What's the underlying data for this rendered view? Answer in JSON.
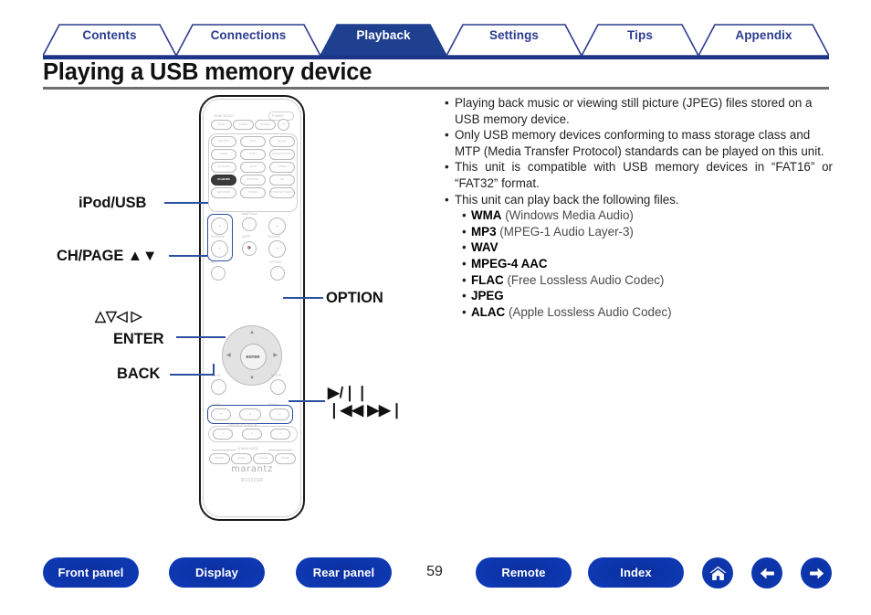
{
  "tabs": [
    {
      "label": "Contents",
      "active": false
    },
    {
      "label": "Connections",
      "active": false
    },
    {
      "label": "Playback",
      "active": true
    },
    {
      "label": "Settings",
      "active": false
    },
    {
      "label": "Tips",
      "active": false
    },
    {
      "label": "Appendix",
      "active": false
    }
  ],
  "page": {
    "title": "Playing a USB memory device",
    "number": "59"
  },
  "notes": [
    {
      "bullet": "•",
      "text": "Playing back music or viewing still picture (JPEG) files stored on a USB memory device."
    },
    {
      "bullet": "•",
      "text": "Only USB memory devices conforming to mass storage class and MTP (Media Transfer Protocol) standards can be played on this unit."
    },
    {
      "bullet": "•",
      "text": "This unit is compatible with USB memory devices in “FAT16” or “FAT32” format."
    },
    {
      "bullet": "•",
      "text": "This unit can play back the following files."
    }
  ],
  "formats": [
    {
      "bullet": "•",
      "name": "WMA",
      "desc": "(Windows Media Audio)"
    },
    {
      "bullet": "•",
      "name": "MP3",
      "desc": "(MPEG-1 Audio Layer-3)"
    },
    {
      "bullet": "•",
      "name": "WAV",
      "desc": ""
    },
    {
      "bullet": "•",
      "name": "MPEG-4 AAC",
      "desc": ""
    },
    {
      "bullet": "•",
      "name": "FLAC",
      "desc": "(Free Lossless Audio Codec)"
    },
    {
      "bullet": "•",
      "name": "JPEG",
      "desc": ""
    },
    {
      "bullet": "•",
      "name": "ALAC",
      "desc": "(Apple Lossless Audio Codec)"
    }
  ],
  "callouts": {
    "ipod_usb": "iPod/USB",
    "ch_page": "CH/PAGE ▲▼",
    "cursor": "△▽◁ ▷",
    "enter": "ENTER",
    "back": "BACK",
    "option": "OPTION",
    "play_pause": "▶/❘❘",
    "skip": "❘◀◀ ▶▶❘"
  },
  "remote": {
    "brand": "marantz",
    "model": "RC022SR",
    "captions": {
      "zone_select": "ZONE SELECT",
      "power": "POWER",
      "ch_page": "CH/PAGE",
      "mute": "MUTE",
      "volume": "VOLUME",
      "info": "INFO",
      "option": "OPTION",
      "back": "BACK",
      "setup": "SETUP",
      "inputs_preview": "InstaPrevue",
      "tune_minus": "TUNE −",
      "tune_plus": "TUNE +",
      "favorite_station": "FAVORITE STATION",
      "sound_mode": "SOUND MODE"
    },
    "buttons": {
      "zone_main": "MAIN",
      "zone2": "ZONE2",
      "zone3": "ZONE3",
      "cbl_sat": "CBL/SAT",
      "dvd": "DVD",
      "bluray": "Blu-ray",
      "game": "GAME",
      "aux1": "AUX1",
      "media_player": "MEDIA PLAYER",
      "tv_audio": "TV AUDIO",
      "aux2": "AUX2",
      "tuner": "TUNER",
      "ipod_usb": "iPod/USB",
      "bt_airplay": "BT/AirPlay",
      "cd": "CD",
      "network": "NETWORK",
      "phono": "PHONO",
      "internet_radio": "INTERNET RADIO",
      "enter": "ENTER",
      "preset1": "1",
      "preset2": "2",
      "preset3": "3",
      "movie": "MOVIE",
      "music": "MUSIC",
      "game_mode": "GAME",
      "pure": "PURE"
    }
  },
  "bottom_nav": {
    "front_panel": "Front panel",
    "display": "Display",
    "rear_panel": "Rear panel",
    "remote": "Remote",
    "index": "Index"
  },
  "colors": {
    "tab_active_fill": "#1f3f8f",
    "tab_text": "#2b3c8e",
    "title_rule_top": "#1d3387",
    "title_rule_bottom": "#6f6f6f",
    "leader_line": "#2b4fa0",
    "pill_blue": "#0e39b4"
  }
}
